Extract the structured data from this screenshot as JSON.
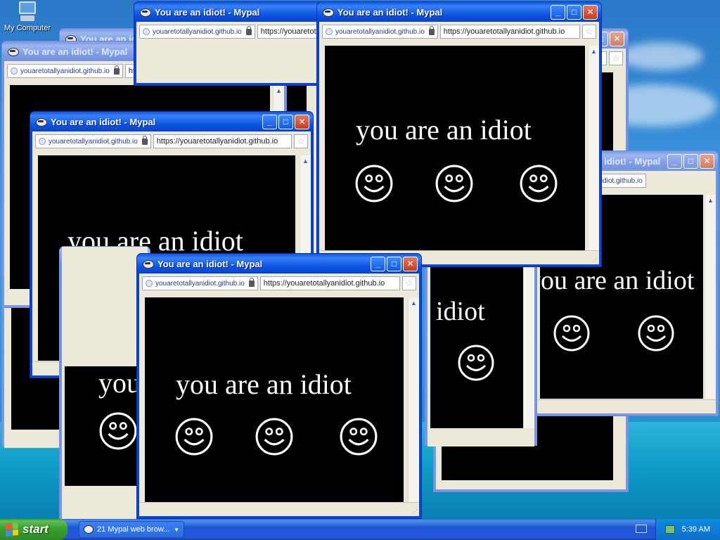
{
  "desktop": {
    "icon_label": "My Computer"
  },
  "window": {
    "title": "You are an idiot! - Mypal",
    "site_identity": "youaretotallyanidiot.github.io",
    "url": "https://youaretotallyanidiot.github.io",
    "page_text": "you are an idiot"
  },
  "taskbar": {
    "start_label": "start",
    "task_label": "21 Mypal web brow...",
    "time": "5:39 AM"
  },
  "colors": {
    "title_active": "#0a5ae8",
    "title_inactive": "#7a96df",
    "content_bg": "#000000",
    "taskbar": "#2157d7",
    "start_button": "#37a02f"
  }
}
